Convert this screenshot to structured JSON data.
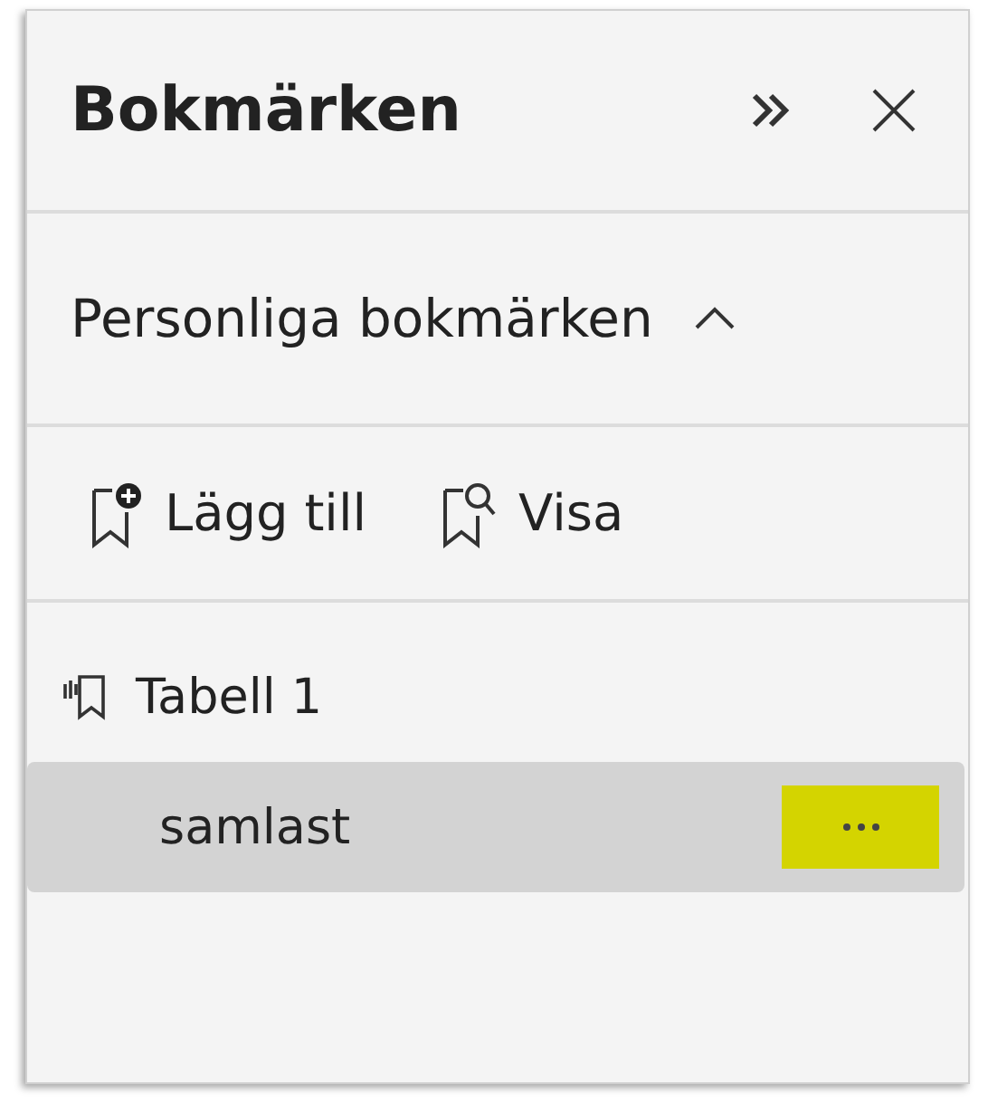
{
  "panel": {
    "title": "Bokmärken"
  },
  "section": {
    "title": "Personliga bokmärken",
    "expanded": true
  },
  "toolbar": [
    {
      "kind": "add",
      "label": "Lägg till"
    },
    {
      "kind": "view",
      "label": "Visa"
    }
  ],
  "tree": [
    {
      "label": "Tabell 1",
      "selected": false,
      "children": [
        {
          "label": "samlast",
          "selected": true,
          "highlighted": true
        }
      ]
    }
  ]
}
